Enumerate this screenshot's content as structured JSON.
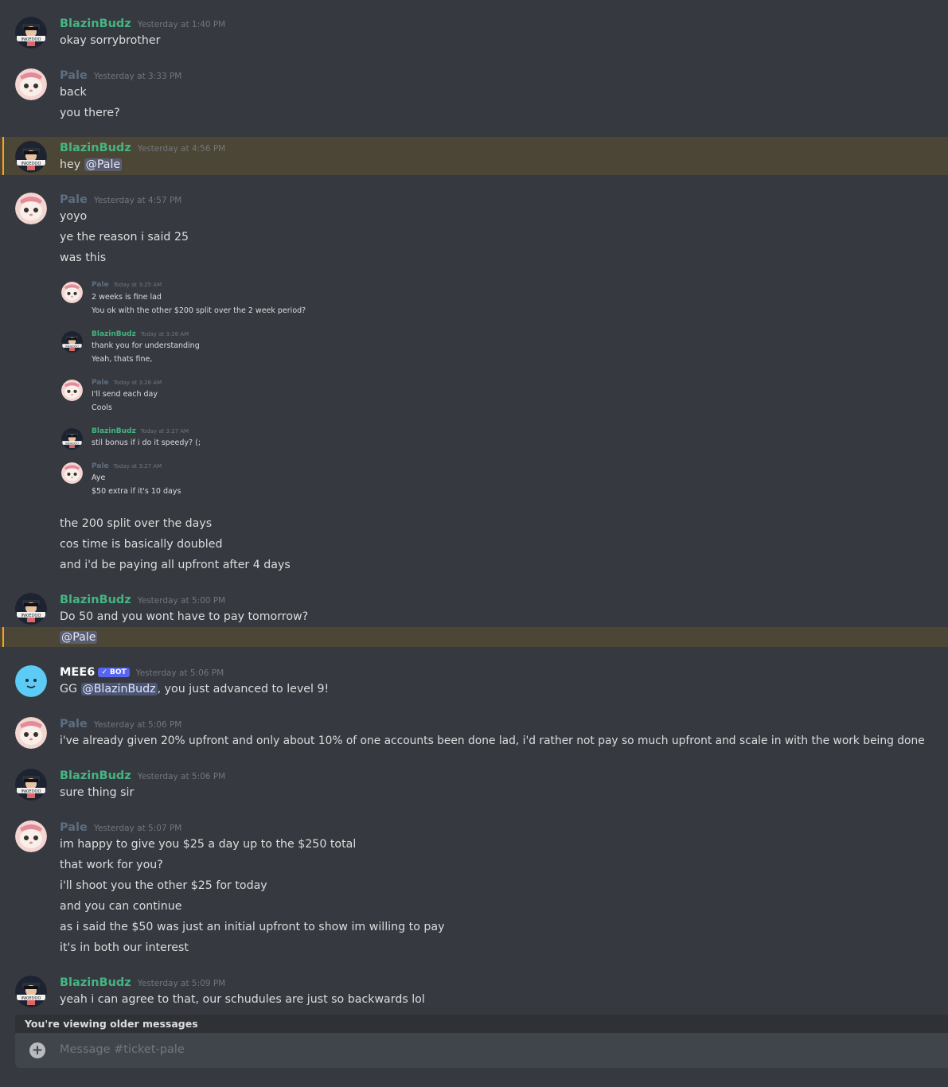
{
  "messages": [
    {
      "user": "BlazinBudz",
      "time": "Yesterday at 1:40 PM",
      "lines": [
        "okay sorrybrother"
      ]
    },
    {
      "user": "Pale",
      "time": "Yesterday at 3:33 PM",
      "lines": [
        "back",
        "you there?"
      ]
    },
    {
      "user": "BlazinBudz",
      "time": "Yesterday at 4:56 PM",
      "text": "hey",
      "mention": "@Pale"
    },
    {
      "user": "Pale",
      "time": "Yesterday at 4:57 PM",
      "lines": [
        "yoyo",
        "ye the reason i said 25",
        "was this",
        "the 200 split over the days",
        "cos time is basically doubled",
        "and i'd be paying all upfront after 4 days"
      ]
    },
    {
      "user": "BlazinBudz",
      "time": "Yesterday at 5:00 PM",
      "lines": [
        "Do 50 and you wont have to pay tomorrow?"
      ],
      "mention": "@Pale"
    },
    {
      "user": "MEE6",
      "badge": "✓ BOT",
      "time": "Yesterday at 5:06 PM",
      "pre": "GG",
      "mention": "@BlazinBudz",
      "post": ", you just advanced to level 9!"
    },
    {
      "user": "Pale",
      "time": "Yesterday at 5:06 PM",
      "lines": [
        "i've already given 20% upfront and only about 10% of one accounts been done lad, i'd rather not pay so much upfront and scale in with the work being done"
      ]
    },
    {
      "user": "BlazinBudz",
      "time": "Yesterday at 5:06 PM",
      "lines": [
        "sure thing sir"
      ]
    },
    {
      "user": "Pale",
      "time": "Yesterday at 5:07 PM",
      "lines": [
        "im happy to give you $25 a day up to the $250 total",
        "that work for you?",
        "i'll shoot you the other $25 for today",
        "and you can continue",
        "as i said the $50 was just an initial upfront to show im willing to pay",
        "it's in both our interest"
      ]
    },
    {
      "user": "BlazinBudz",
      "time": "Yesterday at 5:09 PM",
      "lines": [
        "yeah i can agree to that, our schudules are just so backwards lol"
      ]
    }
  ],
  "embedded": [
    {
      "user": "Pale",
      "time": "Today at 3:25 AM",
      "lines": [
        "2 weeks is fine lad",
        "You ok with the other $200 split over the 2 week period?"
      ]
    },
    {
      "user": "BlazinBudz",
      "time": "Today at 3:26 AM",
      "lines": [
        "thank you for understanding",
        "Yeah, thats fine,"
      ]
    },
    {
      "user": "Pale",
      "time": "Today at 3:26 AM",
      "lines": [
        "I'll send each day",
        "Cools"
      ]
    },
    {
      "user": "BlazinBudz",
      "time": "Today at 3:27 AM",
      "lines": [
        "stil bonus if i do it speedy? (;"
      ]
    },
    {
      "user": "Pale",
      "time": "Today at 3:27 AM",
      "lines": [
        "Aye",
        "$50 extra if it's 10 days"
      ]
    }
  ],
  "footer": {
    "older_notice": "You're viewing older messages",
    "placeholder": "Message #ticket-pale",
    "attach_icon": "plus-circle-icon"
  },
  "colors": {
    "background": "#36393f",
    "highlight": "#4c4636",
    "mention_bar": "#faa61a",
    "blazin_name": "#43b581",
    "pale_name": "#5e6e80"
  }
}
